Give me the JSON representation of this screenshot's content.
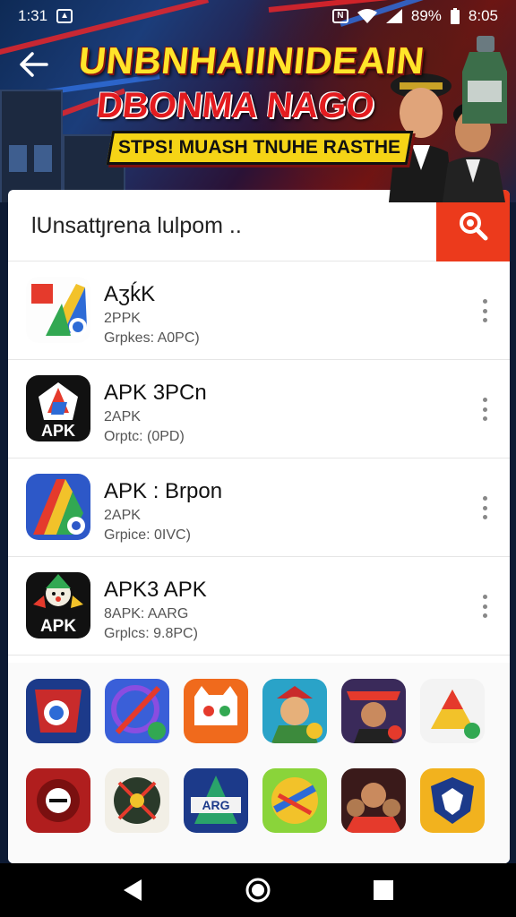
{
  "status_bar": {
    "time": "1:31",
    "right_pct": "89%",
    "right_time": "8:05",
    "icons": [
      "notification-icon",
      "nfc-icon",
      "wifi-icon",
      "signal-icon",
      "battery-icon"
    ]
  },
  "banner": {
    "title_line1": "UNBNHAIINIDEAIN",
    "title_line2": "DBONMA NAGO",
    "ribbon": "STPS! MUASH TNUHE RASTHE"
  },
  "search": {
    "value": "lUnsattȷrena lulpom .."
  },
  "apps": [
    {
      "name": "AӡḱK",
      "sub": "2PPK",
      "meta": "Grpkes: A0PC)",
      "icon": "colorful-arrow-app-icon"
    },
    {
      "name": "APK 3PCn",
      "sub": "2APK",
      "meta": "Orptc: (0PD)",
      "icon": "apk-logo-icon",
      "icon_label": "APK"
    },
    {
      "name": "APK : Brpon",
      "sub": "2APK",
      "meta": "Grpice: 0IVC)",
      "icon": "colorful-a-app-icon"
    },
    {
      "name": "APK3 APK",
      "sub": "8APK: AARG",
      "meta": "Grplcs: 9.8PC)",
      "icon": "clown-apk-icon",
      "icon_label": "APK"
    }
  ],
  "grid_row1": [
    "badge-app-icon",
    "slash-app-icon",
    "chat-bubble-app-icon",
    "soldier-app-icon",
    "character-app-icon",
    "triangle-app-icon"
  ],
  "grid_row2": [
    "red-emblem-app-icon",
    "compass-app-icon",
    "a-letter-app-icon",
    "neon-text-app-icon",
    "group-app-icon",
    "shield-app-icon"
  ],
  "grid_row2_label": "ARG",
  "nav": [
    "back-triangle-icon",
    "home-circle-icon",
    "recents-square-icon"
  ],
  "colors": {
    "accent": "#ec3a1c",
    "banner_yellow": "#ffe52a",
    "banner_red": "#e31b1f"
  }
}
